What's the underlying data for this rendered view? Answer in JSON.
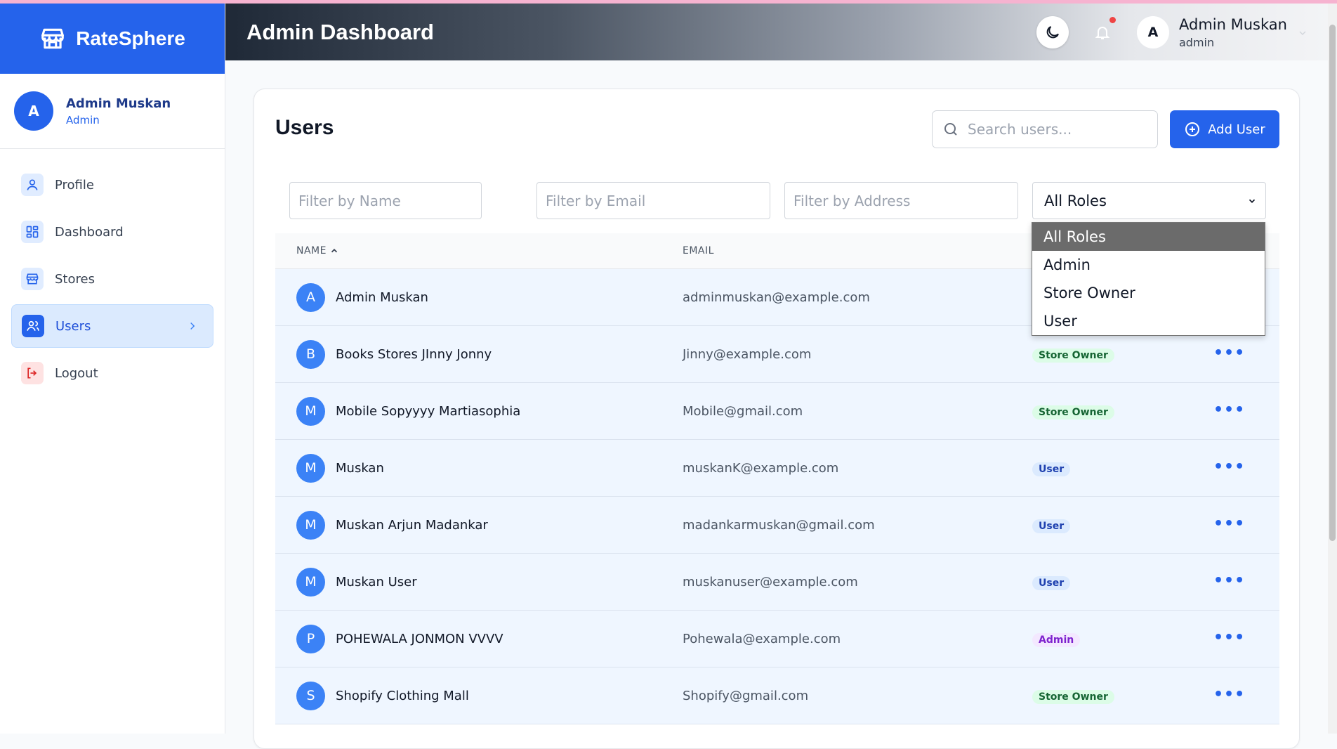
{
  "app": {
    "name": "RateSphere"
  },
  "sidebar": {
    "user": {
      "initial": "A",
      "name": "Admin Muskan",
      "role": "Admin"
    },
    "items": [
      {
        "label": "Profile"
      },
      {
        "label": "Dashboard"
      },
      {
        "label": "Stores"
      },
      {
        "label": "Users"
      },
      {
        "label": "Logout"
      }
    ]
  },
  "header": {
    "title": "Admin Dashboard",
    "user": {
      "initial": "A",
      "name": "Admin Muskan",
      "role": "admin"
    }
  },
  "main": {
    "title": "Users",
    "search_placeholder": "Search users...",
    "add_label": "Add User",
    "filters": {
      "name_placeholder": "Filter by Name",
      "email_placeholder": "Filter by Email",
      "address_placeholder": "Filter by Address",
      "role_selected": "All Roles",
      "role_options": [
        "All Roles",
        "Admin",
        "Store Owner",
        "User"
      ]
    },
    "columns": {
      "name": "NAME",
      "email": "EMAIL"
    },
    "rows": [
      {
        "initial": "A",
        "name": "Admin Muskan",
        "email": "adminmuskan@example.com",
        "role": ""
      },
      {
        "initial": "B",
        "name": "Books Stores JInny Jonny",
        "email": "Jinny@example.com",
        "role": "Store Owner"
      },
      {
        "initial": "M",
        "name": "Mobile Sopyyyy Martiasophia",
        "email": "Mobile@gmail.com",
        "role": "Store Owner"
      },
      {
        "initial": "M",
        "name": "Muskan",
        "email": "muskanK@example.com",
        "role": "User"
      },
      {
        "initial": "M",
        "name": "Muskan Arjun Madankar",
        "email": "madankarmuskan@gmail.com",
        "role": "User"
      },
      {
        "initial": "M",
        "name": "Muskan User",
        "email": "muskanuser@example.com",
        "role": "User"
      },
      {
        "initial": "P",
        "name": "POHEWALA JONMON VVVV",
        "email": "Pohewala@example.com",
        "role": "Admin"
      },
      {
        "initial": "S",
        "name": "Shopify Clothing Mall",
        "email": "Shopify@gmail.com",
        "role": "Store Owner"
      }
    ],
    "row_actions_label": "•••"
  },
  "colors": {
    "accent": "#2563eb",
    "notification": "#ef4444"
  }
}
